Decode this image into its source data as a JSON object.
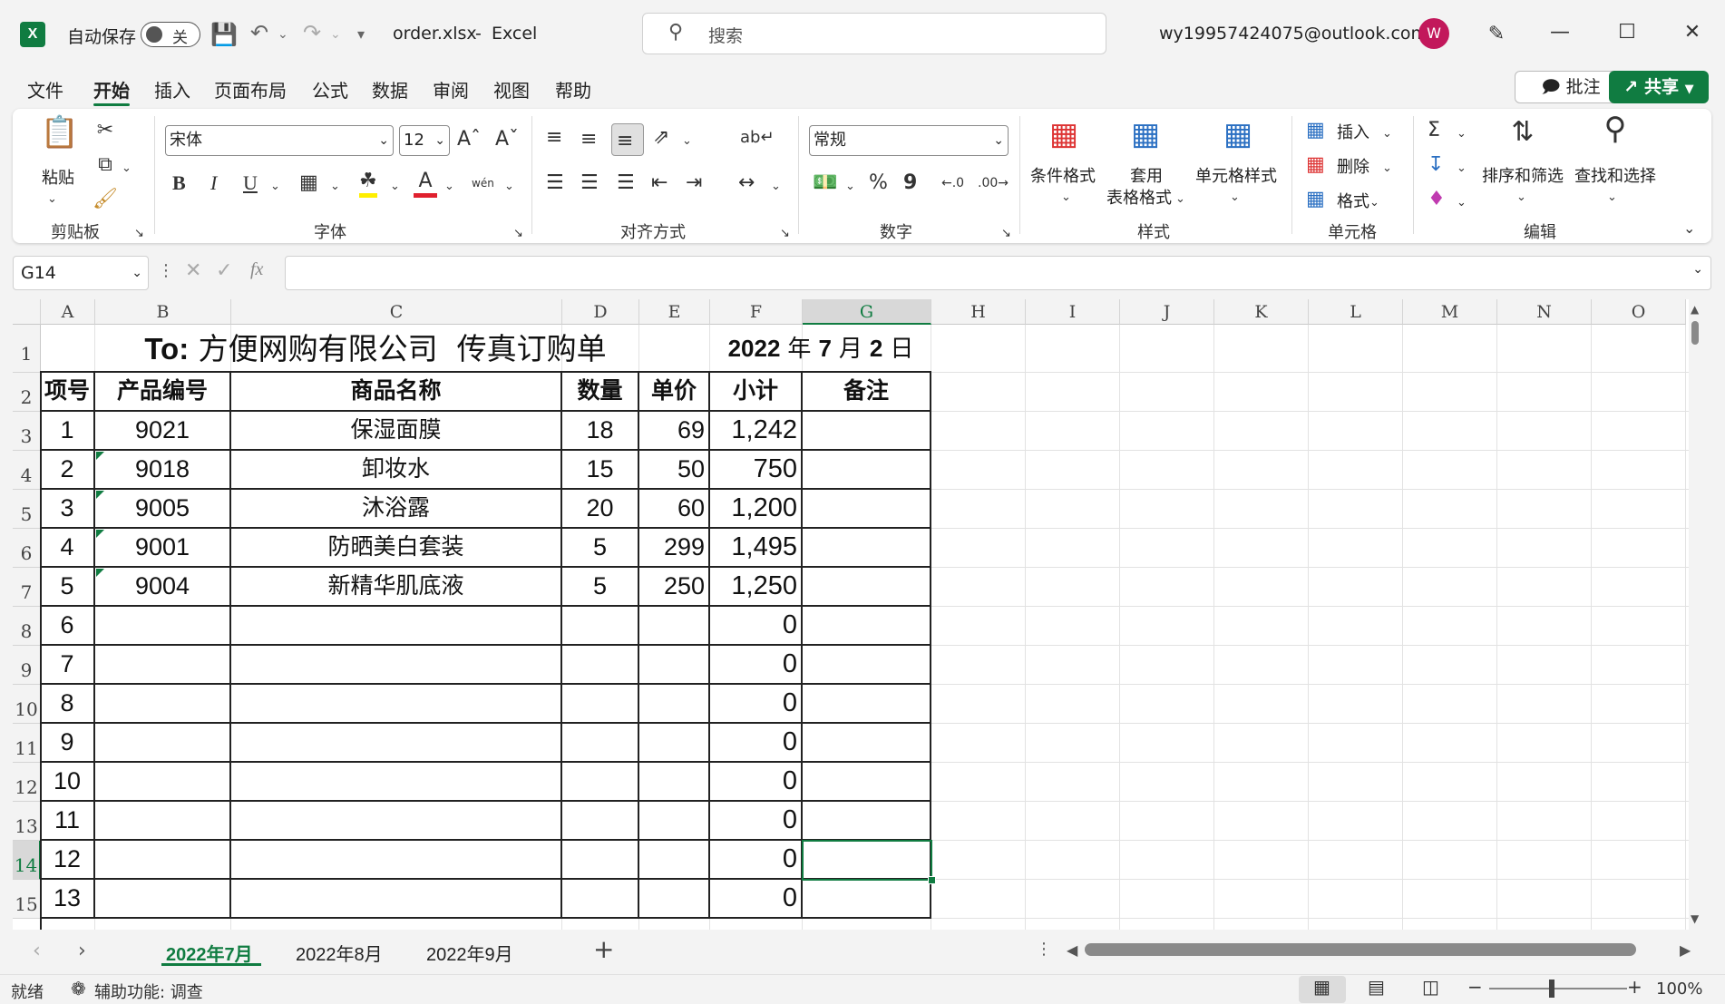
{
  "titlebar": {
    "autosave_label": "自动保存",
    "autosave_state": "关",
    "filename": "order.xlsx",
    "separator": "-",
    "app": "Excel",
    "search_placeholder": "搜索",
    "account": "wy19957424075@outlook.com",
    "avatar_initial": "W"
  },
  "menu": {
    "tabs": [
      "文件",
      "开始",
      "插入",
      "页面布局",
      "公式",
      "数据",
      "审阅",
      "视图",
      "帮助"
    ],
    "active": "开始",
    "comment_label": "批注",
    "share_label": "共享"
  },
  "ribbon": {
    "clipboard": {
      "paste": "粘贴",
      "group": "剪贴板"
    },
    "font": {
      "name": "宋体",
      "size": "12",
      "group": "字体",
      "bold": "B",
      "italic": "I",
      "underline": "U",
      "phonetic": "wén"
    },
    "alignment": {
      "group": "对齐方式"
    },
    "number": {
      "format": "常规",
      "group": "数字",
      "percent": "%",
      "comma": "9"
    },
    "styles": {
      "conditional": "条件格式",
      "table_line1": "套用",
      "table_line2": "表格格式",
      "cell_styles": "单元格样式",
      "group": "样式"
    },
    "cells": {
      "insert": "插入",
      "delete": "删除",
      "format": "格式",
      "group": "单元格"
    },
    "editing": {
      "sort_filter": "排序和筛选",
      "find_select": "查找和选择",
      "group": "编辑"
    }
  },
  "formula_bar": {
    "name_box": "G14",
    "fx": "fx",
    "content": ""
  },
  "sheet": {
    "columns": [
      "A",
      "B",
      "C",
      "D",
      "E",
      "F",
      "G",
      "H",
      "I",
      "J",
      "K",
      "L",
      "M",
      "N",
      "O"
    ],
    "selected_column": "G",
    "selected_row": "14",
    "title": "To: 方便网购有限公司  传真订购单",
    "title_prefix": "To:",
    "title_rest": " 方便网购有限公司  传真订购单",
    "date_year": "2022",
    "date_y": "年",
    "date_month": "7",
    "date_m": "月",
    "date_day": "2",
    "date_d": "日",
    "headers": [
      "项号",
      "产品编号",
      "商品名称",
      "数量",
      "单价",
      "小计",
      "备注"
    ],
    "rows": [
      {
        "row": "3",
        "item": "1",
        "code": "9021",
        "name": "保湿面膜",
        "qty": "18",
        "price": "69",
        "subtotal": "1,242",
        "note": ""
      },
      {
        "row": "4",
        "item": "2",
        "code": "9018",
        "name": "卸妆水",
        "qty": "15",
        "price": "50",
        "subtotal": "750",
        "note": ""
      },
      {
        "row": "5",
        "item": "3",
        "code": "9005",
        "name": "沐浴露",
        "qty": "20",
        "price": "60",
        "subtotal": "1,200",
        "note": ""
      },
      {
        "row": "6",
        "item": "4",
        "code": "9001",
        "name": "防晒美白套装",
        "qty": "5",
        "price": "299",
        "subtotal": "1,495",
        "note": ""
      },
      {
        "row": "7",
        "item": "5",
        "code": "9004",
        "name": "新精华肌底液",
        "qty": "5",
        "price": "250",
        "subtotal": "1,250",
        "note": ""
      },
      {
        "row": "8",
        "item": "6",
        "code": "",
        "name": "",
        "qty": "",
        "price": "",
        "subtotal": "0",
        "note": ""
      },
      {
        "row": "9",
        "item": "7",
        "code": "",
        "name": "",
        "qty": "",
        "price": "",
        "subtotal": "0",
        "note": ""
      },
      {
        "row": "10",
        "item": "8",
        "code": "",
        "name": "",
        "qty": "",
        "price": "",
        "subtotal": "0",
        "note": ""
      },
      {
        "row": "11",
        "item": "9",
        "code": "",
        "name": "",
        "qty": "",
        "price": "",
        "subtotal": "0",
        "note": ""
      },
      {
        "row": "12",
        "item": "10",
        "code": "",
        "name": "",
        "qty": "",
        "price": "",
        "subtotal": "0",
        "note": ""
      },
      {
        "row": "13",
        "item": "11",
        "code": "",
        "name": "",
        "qty": "",
        "price": "",
        "subtotal": "0",
        "note": ""
      },
      {
        "row": "14",
        "item": "12",
        "code": "",
        "name": "",
        "qty": "",
        "price": "",
        "subtotal": "0",
        "note": ""
      },
      {
        "row": "15",
        "item": "13",
        "code": "",
        "name": "",
        "qty": "",
        "price": "",
        "subtotal": "0",
        "note": ""
      }
    ],
    "header_rows": [
      "1",
      "2"
    ]
  },
  "sheet_tabs": {
    "tabs": [
      "2022年7月",
      "2022年8月",
      "2022年9月"
    ],
    "active": "2022年7月",
    "add": "+"
  },
  "status": {
    "ready": "就绪",
    "accessibility": "辅助功能: 调查",
    "zoom": "100%"
  },
  "colors": {
    "accent": "#107c41",
    "avatar": "#c2185b"
  }
}
